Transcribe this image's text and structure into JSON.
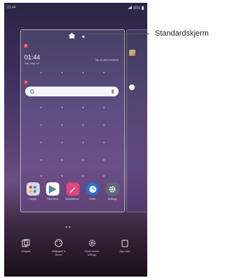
{
  "status": {
    "time": "01:44",
    "battery": "96%"
  },
  "callout": {
    "label": "Standardskjerm"
  },
  "widget": {
    "time": "01:44",
    "date": "Sat, May 14",
    "weather_hint": "Tap to add weather"
  },
  "search": {
    "g": "G"
  },
  "dock_apps": [
    {
      "label": "Google",
      "icon": "google-folder-icon",
      "color": "#d9d7e2"
    },
    {
      "label": "Play Store",
      "icon": "play-store-icon",
      "color": "#ffffff"
    },
    {
      "label": "QuickMemo+",
      "icon": "quickmemo-icon",
      "color": "#e0457b"
    },
    {
      "label": "Clock",
      "icon": "clock-icon",
      "color": "#2b6fd4"
    },
    {
      "label": "Settings",
      "icon": "settings-icon",
      "color": "#5f6577"
    }
  ],
  "options": [
    {
      "label": "Widgets",
      "icon": "widgets-icon"
    },
    {
      "label": "Wallpaper &\ntheme",
      "icon": "palette-icon"
    },
    {
      "label": "Home screen\nsettings",
      "icon": "gear-icon"
    },
    {
      "label": "App trash",
      "icon": "trash-icon"
    }
  ]
}
